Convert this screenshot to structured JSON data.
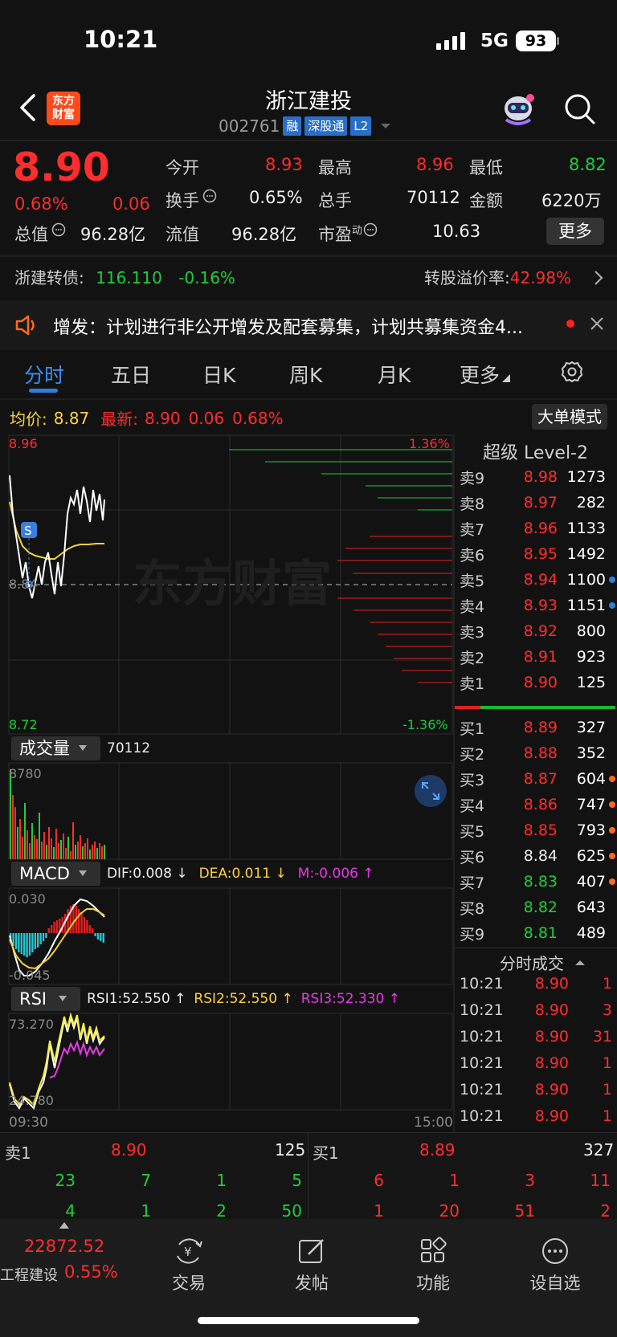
{
  "status": {
    "time": "10:21",
    "network": "5G",
    "battery": "93"
  },
  "header": {
    "logo": "东方财富",
    "title": "浙江建投",
    "code": "002761",
    "tags": [
      "融",
      "深股通",
      "L2"
    ]
  },
  "quote": {
    "price": "8.90",
    "change_pct": "0.68%",
    "change": "0.06",
    "open_label": "今开",
    "open": "8.93",
    "high_label": "最高",
    "high": "8.96",
    "low_label": "最低",
    "low": "8.82",
    "turnover_label": "换手",
    "turnover": "0.65%",
    "volume_label": "总手",
    "volume": "70112",
    "amount_label": "金额",
    "amount": "6220万",
    "mktcap_label": "总值",
    "mktcap": "96.28亿",
    "float_label": "流值",
    "float": "96.28亿",
    "pe_label": "市盈",
    "pe_sup": "动",
    "pe": "10.63",
    "more": "更多"
  },
  "bond": {
    "name": "浙建转债:",
    "price": "116.110",
    "change": "-0.16%",
    "premium_label": "转股溢价率:",
    "premium": "42.98%"
  },
  "notice": {
    "text": "增发：计划进行非公开增发及配套募集，计划共募集资金4..."
  },
  "tabs": [
    "分时",
    "五日",
    "日K",
    "周K",
    "月K",
    "更多"
  ],
  "intraday": {
    "avg_label": "均价:",
    "avg": "8.87",
    "latest_label": "最新:",
    "latest": "8.90",
    "latest_chg": "0.06",
    "latest_pct": "0.68%",
    "bigorder": "大单模式",
    "y_top": "8.96",
    "y_mid": "8.84",
    "y_bottom": "8.72",
    "pct_top": "1.36%",
    "pct_bottom": "-1.36%",
    "watermark": "东方财富",
    "marker": "S",
    "time_start": "09:30",
    "time_end": "15:00"
  },
  "volume_panel": {
    "label": "成交量",
    "value": "70112",
    "max": "8780"
  },
  "macd_panel": {
    "label": "MACD",
    "dif": "DIF:0.008 ↓",
    "dea": "DEA:0.011 ↓",
    "m": "M:-0.006 ↑",
    "y_top": "0.030",
    "y_bottom": "-0.045"
  },
  "rsi_panel": {
    "label": "RSI",
    "rsi1": "RSI1:52.550 ↑",
    "rsi2": "RSI2:52.550 ↑",
    "rsi3": "RSI3:52.330 ↑",
    "y_top": "73.270",
    "y_bottom": "24.780"
  },
  "orderbook": {
    "title": "超级 Level-2",
    "asks": [
      {
        "label": "卖9",
        "price": "8.98",
        "vol": "1273",
        "color": "red",
        "dot": ""
      },
      {
        "label": "卖8",
        "price": "8.97",
        "vol": "282",
        "color": "red",
        "dot": ""
      },
      {
        "label": "卖7",
        "price": "8.96",
        "vol": "1133",
        "color": "red",
        "dot": ""
      },
      {
        "label": "卖6",
        "price": "8.95",
        "vol": "1492",
        "color": "red",
        "dot": ""
      },
      {
        "label": "卖5",
        "price": "8.94",
        "vol": "1100",
        "color": "red",
        "dot": "#2f7de0"
      },
      {
        "label": "卖4",
        "price": "8.93",
        "vol": "1151",
        "color": "red",
        "dot": "#2f7de0"
      },
      {
        "label": "卖3",
        "price": "8.92",
        "vol": "800",
        "color": "red",
        "dot": ""
      },
      {
        "label": "卖2",
        "price": "8.91",
        "vol": "923",
        "color": "red",
        "dot": ""
      },
      {
        "label": "卖1",
        "price": "8.90",
        "vol": "125",
        "color": "red",
        "dot": ""
      }
    ],
    "bids": [
      {
        "label": "买1",
        "price": "8.89",
        "vol": "327",
        "color": "red",
        "dot": ""
      },
      {
        "label": "买2",
        "price": "8.88",
        "vol": "352",
        "color": "red",
        "dot": ""
      },
      {
        "label": "买3",
        "price": "8.87",
        "vol": "604",
        "color": "red",
        "dot": "#ff6a1a"
      },
      {
        "label": "买4",
        "price": "8.86",
        "vol": "747",
        "color": "red",
        "dot": "#ff6a1a"
      },
      {
        "label": "买5",
        "price": "8.85",
        "vol": "793",
        "color": "red",
        "dot": "#ff6a1a"
      },
      {
        "label": "买6",
        "price": "8.84",
        "vol": "625",
        "color": "white",
        "dot": "#ff6a1a"
      },
      {
        "label": "买7",
        "price": "8.83",
        "vol": "407",
        "color": "green",
        "dot": "#ff6a1a"
      },
      {
        "label": "买8",
        "price": "8.82",
        "vol": "643",
        "color": "green",
        "dot": ""
      },
      {
        "label": "买9",
        "price": "8.81",
        "vol": "489",
        "color": "green",
        "dot": ""
      }
    ],
    "ticks_title": "分时成交",
    "ticks": [
      {
        "time": "10:21",
        "price": "8.90",
        "vol": "1"
      },
      {
        "time": "10:21",
        "price": "8.90",
        "vol": "3"
      },
      {
        "time": "10:21",
        "price": "8.90",
        "vol": "31"
      },
      {
        "time": "10:21",
        "price": "8.90",
        "vol": "1"
      },
      {
        "time": "10:21",
        "price": "8.90",
        "vol": "1"
      },
      {
        "time": "10:21",
        "price": "8.90",
        "vol": "1"
      }
    ]
  },
  "level1": {
    "sell_label": "卖1",
    "sell_price": "8.90",
    "sell_vol": "125",
    "buy_label": "买1",
    "buy_price": "8.89",
    "buy_vol": "327",
    "sell_queue": [
      [
        "23",
        "7",
        "1",
        "5"
      ],
      [
        "4",
        "1",
        "2",
        "50"
      ]
    ],
    "buy_queue": [
      [
        "6",
        "1",
        "3",
        "11"
      ],
      [
        "1",
        "20",
        "51",
        "2"
      ]
    ]
  },
  "nav": {
    "index_value": "22872.52",
    "index_name": "工程建设",
    "index_pct": "0.55%",
    "items": [
      "交易",
      "发帖",
      "功能",
      "设自选"
    ]
  }
}
